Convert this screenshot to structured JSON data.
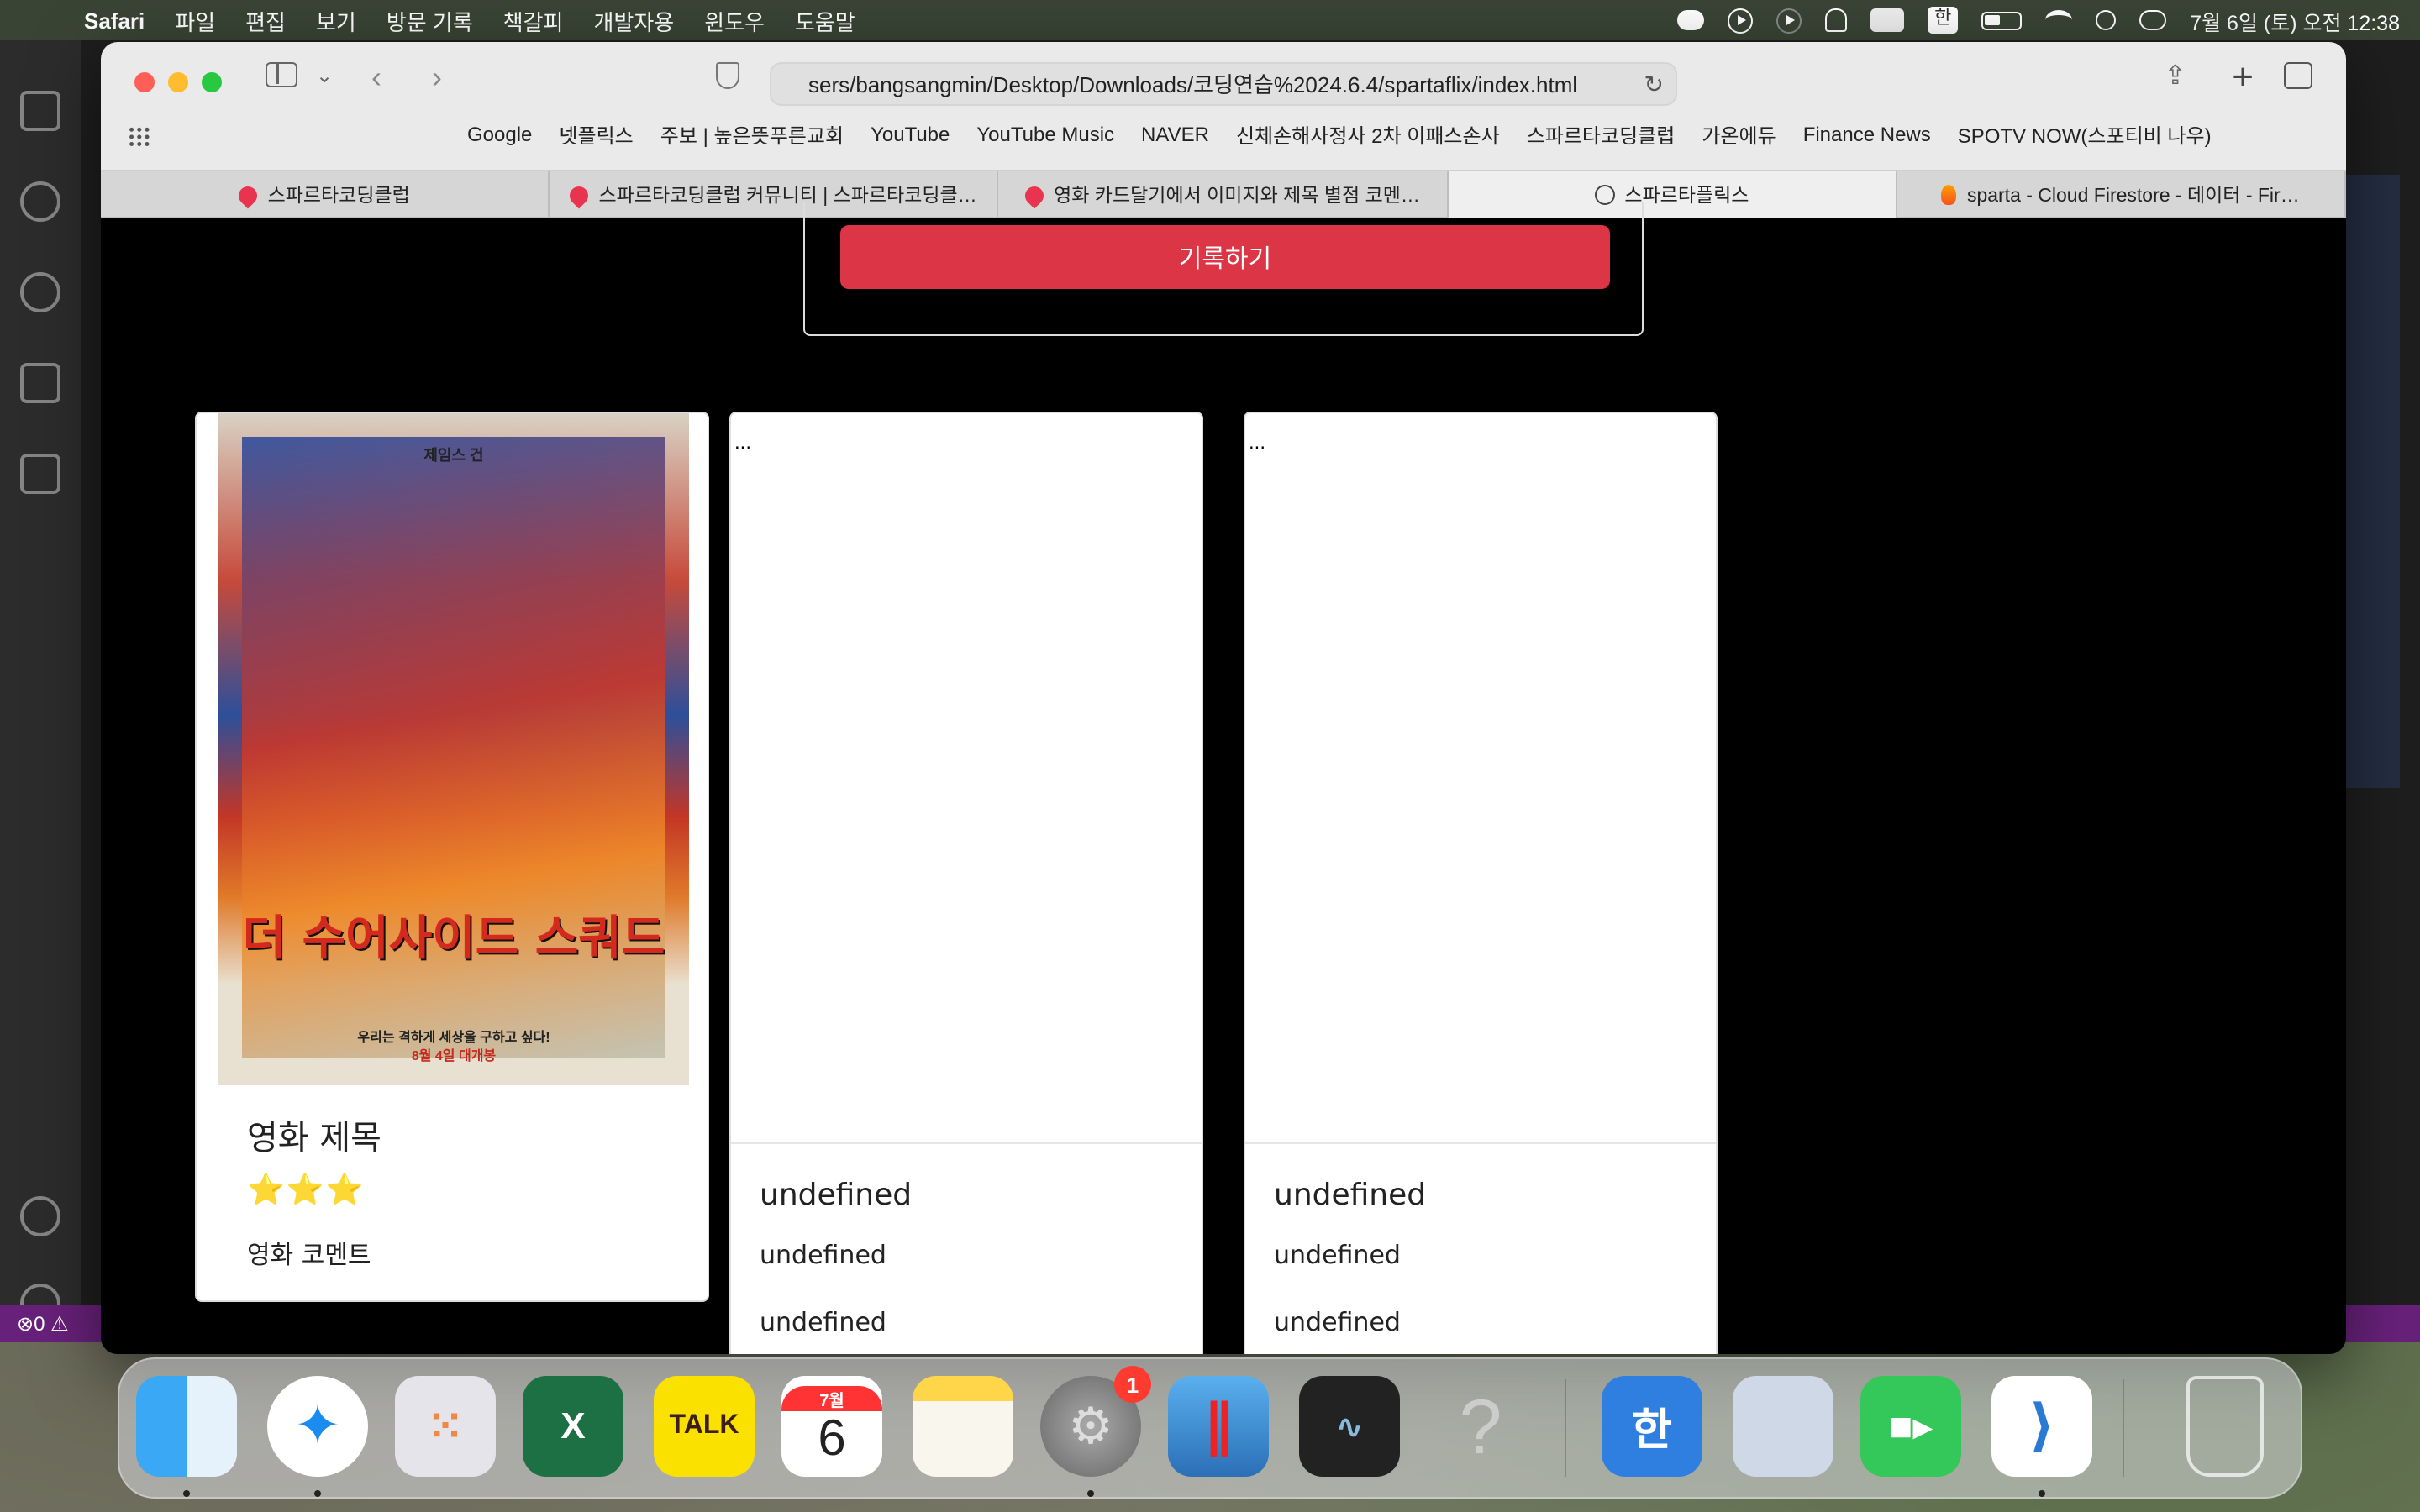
{
  "menubar": {
    "app_name": "Safari",
    "menus": [
      "파일",
      "편집",
      "보기",
      "방문 기록",
      "책갈피",
      "개발자용",
      "윈도우",
      "도움말"
    ],
    "ime": "한",
    "clock": "7월 6일 (토) 오전 12:38"
  },
  "safari": {
    "address": "sers/bangsangmin/Desktop/Downloads/코딩연습%2024.6.4/spartaflix/index.html",
    "bookmarks": [
      "Google",
      "넷플릭스",
      "주보 | 높은뜻푸른교회",
      "YouTube",
      "YouTube Music",
      "NAVER",
      "신체손해사정사 2차 이패스손사",
      "스파르타코딩클럽",
      "가온에듀",
      "Finance News",
      "SPOTV NOW(스포티비 나우)"
    ],
    "tabs": [
      {
        "label": "스파르타코딩클럽",
        "icon": "sparta-icon"
      },
      {
        "label": "스파르타코딩클럽 커뮤니티 | 스파르타코딩클…",
        "icon": "sparta-icon"
      },
      {
        "label": "영화 카드달기에서 이미지와 제목 별점 코멘…",
        "icon": "sparta-icon"
      },
      {
        "label": "스파르타플릭스",
        "icon": "compass-icon",
        "active": true
      },
      {
        "label": "sparta - Cloud Firestore - 데이터 - Fir…",
        "icon": "firebase-icon"
      }
    ]
  },
  "page": {
    "record_button": "기록하기",
    "poster": {
      "top_text": "제임스 건",
      "title": "더 수어사이드 스쿼드",
      "tagline": "우리는 격하게 세상을 구하고 싶다!",
      "release": "8월 4일 대개봉"
    },
    "cards": [
      {
        "title": "영화 제목",
        "stars": "⭐⭐⭐",
        "comment": "영화 코멘트"
      },
      {
        "img_alt": "...",
        "title": "undefined",
        "line1": "undefined",
        "line2": "undefined"
      },
      {
        "img_alt": "...",
        "title": "undefined",
        "line1": "undefined",
        "line2": "undefined"
      }
    ]
  },
  "vscode": {
    "status_errors": "0"
  },
  "dock": {
    "calendar_month": "7월",
    "calendar_day": "6",
    "kakaotalk_label": "TALK",
    "settings_badge": "1",
    "hancom_label": "한"
  }
}
